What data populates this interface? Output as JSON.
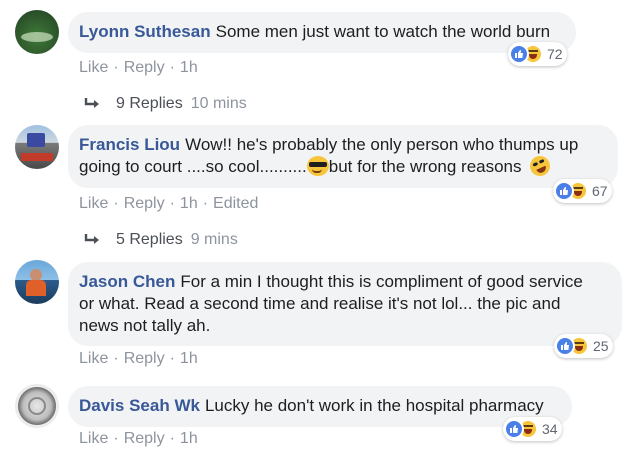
{
  "comments": [
    {
      "author": "Lyonn Suthesan",
      "text": "Some men just want to watch the world burn",
      "text2": "",
      "actions": {
        "like": "Like",
        "reply": "Reply",
        "time": "1h",
        "edited": ""
      },
      "reactions": 72,
      "replies": {
        "count": "9 Replies",
        "time": "10 mins"
      }
    },
    {
      "author": "Francis Liou",
      "text": "Wow!! he's probably the only person who thumps up",
      "text2a": "going to court ....so cool..........",
      "text2b": "but for the wrong reasons",
      "actions": {
        "like": "Like",
        "reply": "Reply",
        "time": "1h",
        "edited": "Edited"
      },
      "reactions": 67,
      "replies": {
        "count": "5 Replies",
        "time": "9 mins"
      }
    },
    {
      "author": "Jason Chen",
      "text": "For a min I thought this is compliment of good service",
      "line2": "or what. Read a second time and realise it's not lol... the pic and",
      "line3": "news not tally ah.",
      "actions": {
        "like": "Like",
        "reply": "Reply",
        "time": "1h"
      },
      "reactions": 25
    },
    {
      "author": "Davis Seah Wk",
      "text": "Lucky he don't work in the hospital pharmacy",
      "actions": {
        "like": "Like",
        "reply": "Reply",
        "time": "1h"
      },
      "reactions": 34
    }
  ],
  "separator": "·",
  "colors": {
    "author": "#385898",
    "bubble": "#f2f3f5",
    "meta": "#8d949e",
    "like_blue": "#4a7fe8",
    "haha_yellow": "#f7c53b"
  }
}
